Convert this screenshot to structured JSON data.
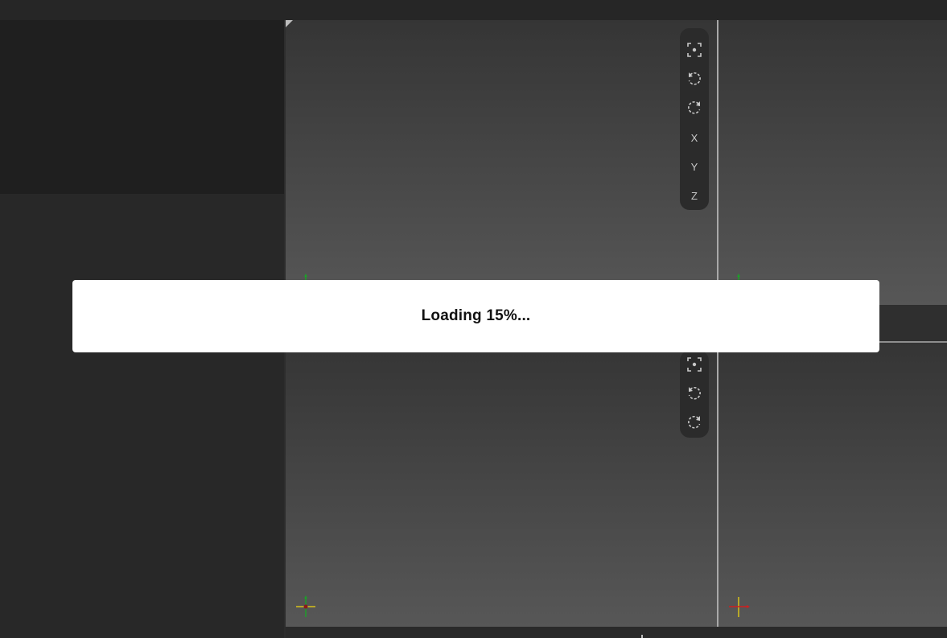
{
  "loading": {
    "message": "Loading 15%...",
    "progress_percent": 15
  },
  "viewport_toolbar_top": {
    "buttons": [
      {
        "icon": "focus-icon",
        "label": ""
      },
      {
        "icon": "rotate-ccw-icon",
        "label": ""
      },
      {
        "icon": "rotate-cw-icon",
        "label": ""
      },
      {
        "icon": "axis-x",
        "label": "X"
      },
      {
        "icon": "axis-y",
        "label": "Y"
      },
      {
        "icon": "axis-z",
        "label": "Z"
      }
    ]
  },
  "viewport_toolbar_bottom": {
    "buttons": [
      {
        "icon": "focus-icon",
        "label": ""
      },
      {
        "icon": "rotate-ccw-icon",
        "label": ""
      },
      {
        "icon": "rotate-cw-icon",
        "label": ""
      }
    ]
  },
  "colors": {
    "axis_x": "#d01f1f",
    "axis_y": "#1e9e2a",
    "axis_z": "#d6c21a",
    "panel_dark": "#1f1f1f",
    "viewport_top": "#353535",
    "viewport_bottom": "#575757",
    "modal_bg": "#ffffff"
  }
}
